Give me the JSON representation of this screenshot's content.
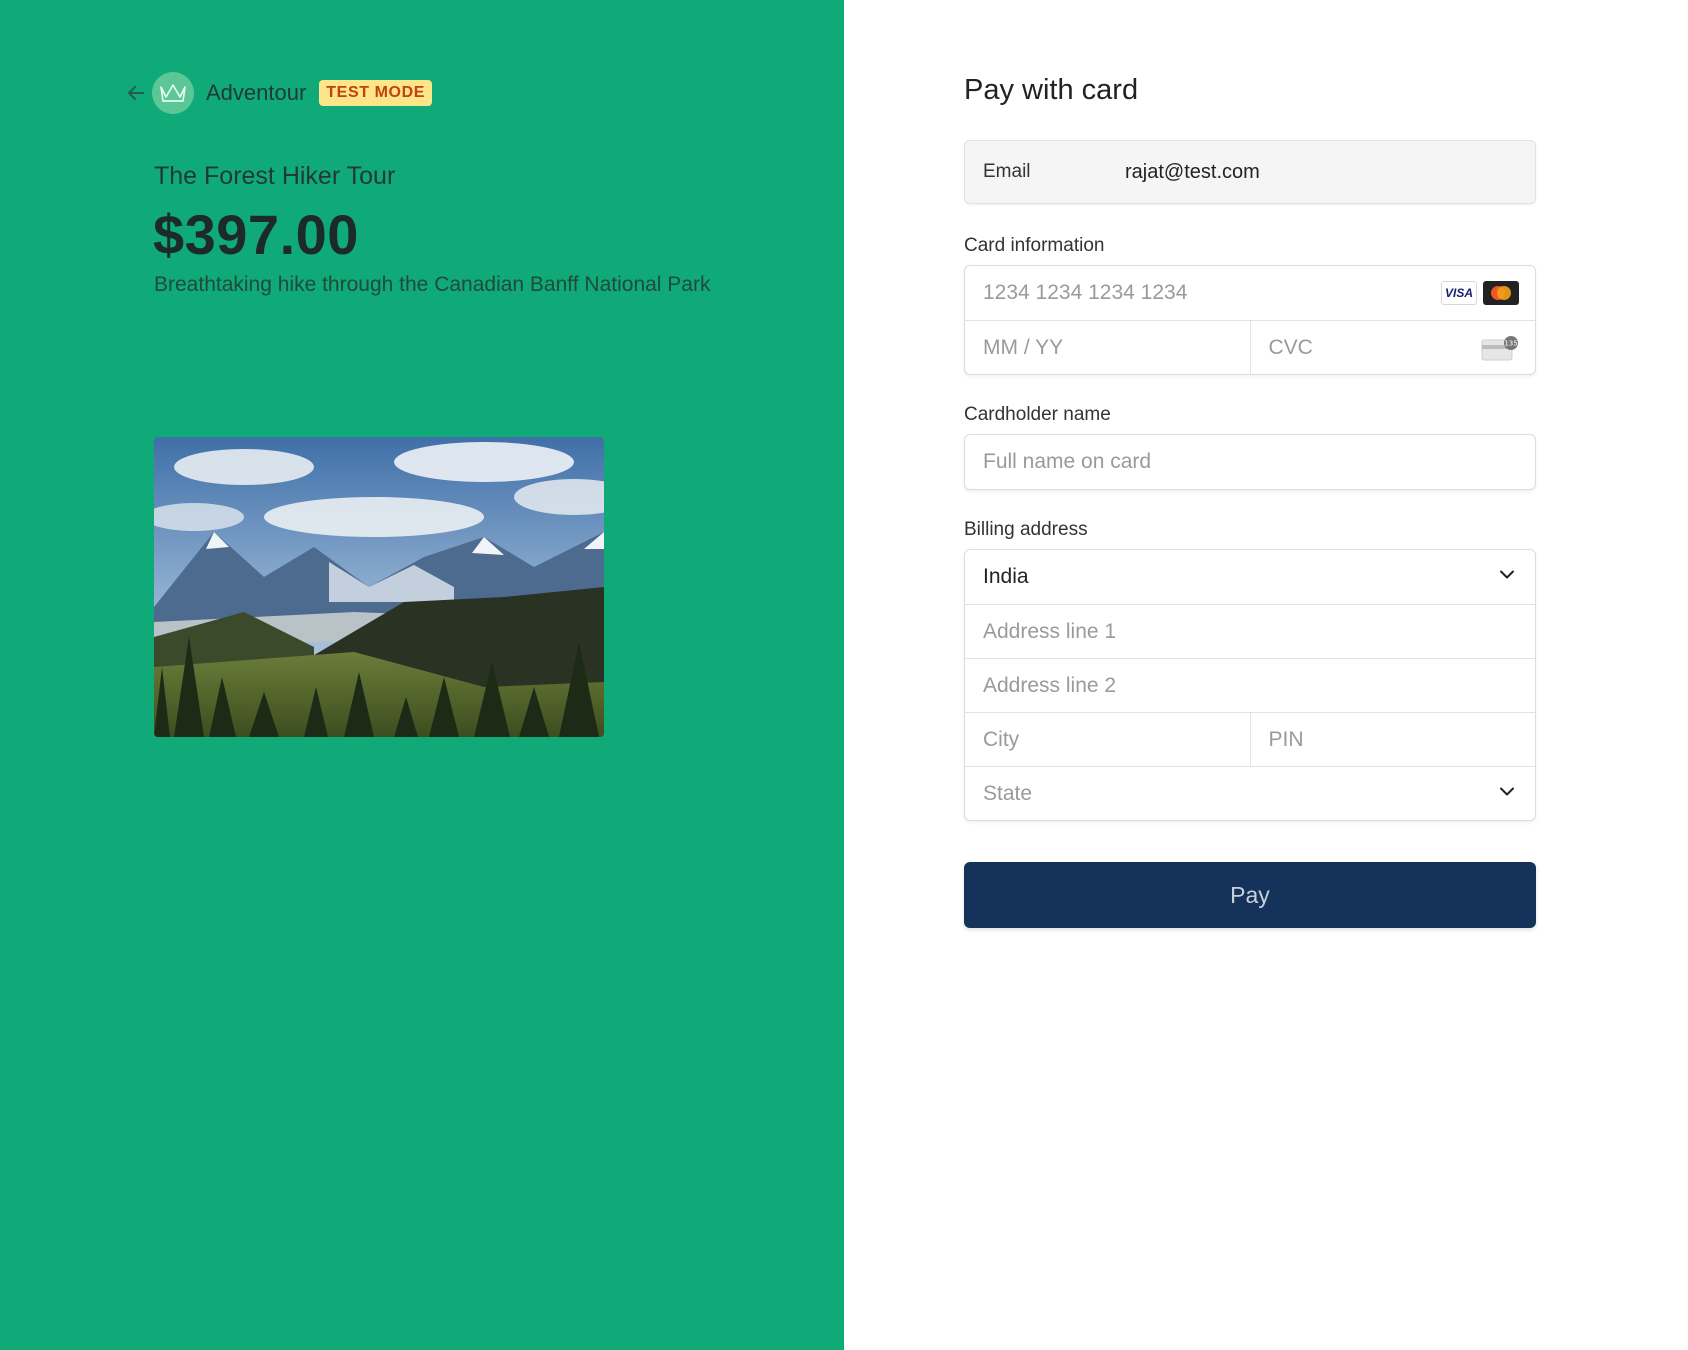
{
  "merchant": {
    "name": "Adventour",
    "badge": "TEST MODE"
  },
  "product": {
    "name": "The Forest Hiker Tour",
    "price": "$397.00",
    "description": "Breathtaking hike through the Canadian Banff National Park",
    "image_icon": "mountain-landscape-image"
  },
  "payment": {
    "title": "Pay with card",
    "email_label": "Email",
    "email_value": "rajat@test.com",
    "card_section_label": "Card information",
    "card_number_placeholder": "1234 1234 1234 1234",
    "expiry_placeholder": "MM / YY",
    "cvc_placeholder": "CVC",
    "visa_label": "VISA",
    "cvc_icon_text": "135",
    "cardholder_label": "Cardholder name",
    "cardholder_placeholder": "Full name on card",
    "billing_label": "Billing address",
    "country_value": "India",
    "address1_placeholder": "Address line 1",
    "address2_placeholder": "Address line 2",
    "city_placeholder": "City",
    "pin_placeholder": "PIN",
    "state_placeholder": "State",
    "pay_button_label": "Pay"
  },
  "colors": {
    "left_bg": "#10aa78",
    "pay_button_bg": "#15325a",
    "badge_bg": "#fde68a",
    "badge_text": "#c2410c"
  }
}
